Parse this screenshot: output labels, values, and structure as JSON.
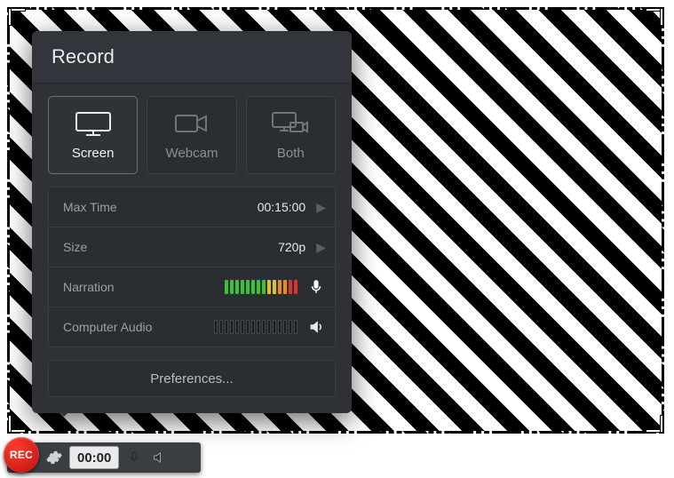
{
  "panel": {
    "title": "Record",
    "modes": {
      "screen": "Screen",
      "webcam": "Webcam",
      "both": "Both",
      "active": "screen"
    },
    "options": {
      "max_time": {
        "label": "Max Time",
        "value": "00:15:00"
      },
      "size": {
        "label": "Size",
        "value": "720p"
      },
      "narration": {
        "label": "Narration",
        "icon": "microphone-icon",
        "level_pattern": "ggggggggyyoorr"
      },
      "computer_audio": {
        "label": "Computer Audio",
        "icon": "speaker-icon",
        "enabled": false,
        "bars": 16
      }
    },
    "preferences_label": "Preferences..."
  },
  "toolbar": {
    "rec_label": "REC",
    "timer": "00:00"
  },
  "colors": {
    "panel_bg": "#2e3237",
    "rec_red": "#d8362a"
  }
}
